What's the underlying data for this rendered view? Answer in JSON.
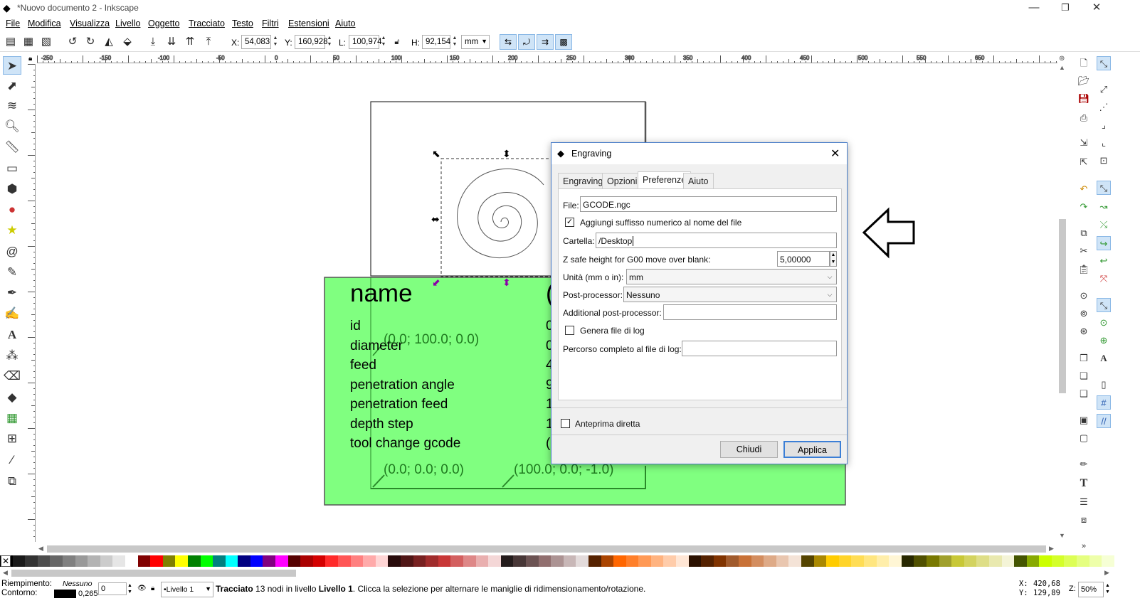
{
  "window": {
    "title": "*Nuovo documento 2 - Inkscape",
    "minimize": "—",
    "maximize": "❐",
    "close": "✕"
  },
  "menu": [
    "File",
    "Modifica",
    "Visualizza",
    "Livello",
    "Oggetto",
    "Tracciato",
    "Testo",
    "Filtri",
    "Estensioni",
    "Aiuto"
  ],
  "toolbar": {
    "x_label": "X:",
    "x_value": "54,083",
    "y_label": "Y:",
    "y_value": "160,928",
    "w_label": "L:",
    "w_value": "100,974",
    "h_label": "H:",
    "h_value": "92,154",
    "unit": "mm"
  },
  "ruler_labels": [
    "-250",
    "-150",
    "-100",
    "-50",
    "0",
    "50",
    "100",
    "150",
    "200",
    "250",
    "300",
    "350",
    "400",
    "450",
    "500",
    "550",
    "650"
  ],
  "canvas": {
    "card_title": "name",
    "card_rows": [
      "id",
      "diameter",
      "feed",
      "penetration angle",
      "penetration feed",
      "depth step",
      "tool change gcode"
    ],
    "card_values": [
      "(",
      "0",
      "0",
      "4",
      "9",
      "1",
      "1",
      "("
    ],
    "coord_top": "(0.0; 100.0; 0.0)",
    "coord_bl": "(0.0; 0.0; 0.0)",
    "coord_br": "(100.0; 0.0; -1.0)"
  },
  "dialog": {
    "title": "Engraving",
    "tabs": [
      "Engraving",
      "Opzioni",
      "Preferenze",
      "Aiuto"
    ],
    "active_tab": "Preferenze",
    "file_label": "File:",
    "file_value": "GCODE.ngc",
    "suffix_label": "Aggiungi suffisso numerico al nome del file",
    "suffix_checked": true,
    "folder_label": "Cartella:",
    "folder_value": "/Desktop",
    "zsafe_label": "Z safe height for G00 move over blank:",
    "zsafe_value": "5,00000",
    "units_label": "Unità (mm o in):",
    "units_value": "mm",
    "post_label": "Post-processor:",
    "post_value": "Nessuno",
    "addpost_label": "Additional post-processor:",
    "addpost_value": "",
    "log_label": "Genera file di log",
    "log_checked": false,
    "logpath_label": "Percorso completo al file di log:",
    "logpath_value": "",
    "preview_label": "Anteprima diretta",
    "preview_checked": false,
    "close_button": "Chiudi",
    "apply_button": "Applica"
  },
  "status": {
    "fill_label": "Riempimento:",
    "fill_value": "Nessuno",
    "stroke_label": "Contorno:",
    "stroke_width": "0,265",
    "opacity_value": "0",
    "layer_value": "•Livello 1",
    "message_bold1": "Tracciato",
    "message_mid": " 13 nodi in livello ",
    "message_bold2": "Livello 1",
    "message_end": ". Clicca la selezione per alternare le maniglie di ridimensionamento/rotazione.",
    "coord_x_label": "X:",
    "coord_x": "420,68",
    "coord_y_label": "Y:",
    "coord_y": "129,89",
    "zoom_label": "Z:",
    "zoom_value": "50%"
  },
  "colors": {
    "accent": "#4a7ec9",
    "card_green": "#80ff80",
    "card_border": "#2a8a2a",
    "selection_blue": "#cfe4f7"
  }
}
